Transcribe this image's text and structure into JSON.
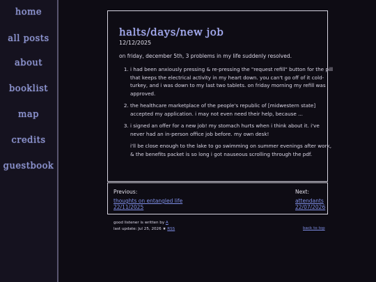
{
  "sidebar": {
    "items": [
      {
        "label": "home"
      },
      {
        "label": "all posts"
      },
      {
        "label": "about"
      },
      {
        "label": "booklist"
      },
      {
        "label": "map"
      },
      {
        "label": "credits"
      },
      {
        "label": "guestbook"
      }
    ]
  },
  "post": {
    "title": "halts/days/new job",
    "date": "12/12/2025",
    "intro": "on friday, december 5th, 3 problems in my life suddenly resolved.",
    "items": [
      "i had been anxiously pressing & re-pressing the \"request refill\" button for the pill that keeps the electrical activity in my heart down. you can't go off of it cold-turkey, and i was down to my last two tablets. on friday morning my refill was approved.",
      "the healthcare marketplace of the people's republic of [midwestern state] accepted my application. i may not even need their help, because ...",
      "i signed an offer for a new job! my stomach hurts when i think about it. i've never had an in-person office job before. my own desk!"
    ],
    "item3_extra": "i'll be close enough to the lake to go swimming on summer evenings after work, & the benefits packet is so long i got nauseous scrolling through the pdf."
  },
  "nav": {
    "previous_label": "Previous:",
    "previous_title": "thoughts on entangled life",
    "previous_date": "22/11/2025",
    "next_label": "Next:",
    "next_title": "attendants",
    "next_date": "22/07/2026"
  },
  "footer": {
    "line1_text": "good listener is written by ",
    "line1_link": "A",
    "line2_text": "last update: Jul 25, 2026 ★ ",
    "line2_link": "RSS",
    "back_to_top": "back to top"
  },
  "colors": {
    "background": "#0e0c14",
    "sidebar_bg": "#15121f",
    "accent": "#8f97d8",
    "link": "#7f8fe8",
    "border": "#d8d6e2"
  }
}
